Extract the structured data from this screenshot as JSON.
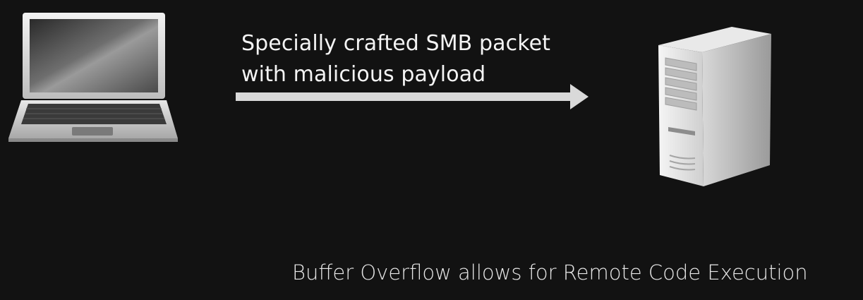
{
  "diagram": {
    "packet_label_line1": "Specially crafted SMB packet",
    "packet_label_line2": "with malicious payload",
    "caption": "Buffer Overflow allows for Remote Code Execution"
  },
  "icons": {
    "attacker": "laptop-icon",
    "direction": "arrow-right-icon",
    "target": "server-tower-icon"
  },
  "colors": {
    "background": "#121212",
    "arrow": "#d9d9d9",
    "text": "#f2f2f2"
  }
}
